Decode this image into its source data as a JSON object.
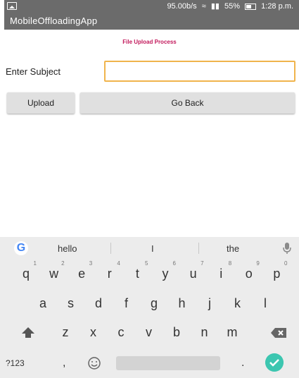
{
  "status_bar": {
    "speed": "95.00b/s",
    "battery": "55%",
    "time": "1:28 p.m."
  },
  "app": {
    "title": "MobileOffloadingApp"
  },
  "form": {
    "heading": "File Upload Process",
    "subject_label": "Enter Subject",
    "subject_value": "",
    "upload_label": "Upload",
    "go_back_label": "Go Back"
  },
  "keyboard": {
    "suggestions": [
      "hello",
      "I",
      "the"
    ],
    "row1": [
      {
        "k": "q",
        "n": "1"
      },
      {
        "k": "w",
        "n": "2"
      },
      {
        "k": "e",
        "n": "3"
      },
      {
        "k": "r",
        "n": "4"
      },
      {
        "k": "t",
        "n": "5"
      },
      {
        "k": "y",
        "n": "6"
      },
      {
        "k": "u",
        "n": "7"
      },
      {
        "k": "i",
        "n": "8"
      },
      {
        "k": "o",
        "n": "9"
      },
      {
        "k": "p",
        "n": "0"
      }
    ],
    "row2": [
      "a",
      "s",
      "d",
      "f",
      "g",
      "h",
      "j",
      "k",
      "l"
    ],
    "row3": [
      "z",
      "x",
      "c",
      "v",
      "b",
      "n",
      "m"
    ],
    "symbols_label": "?123",
    "comma": ",",
    "period": ".",
    "icons": [
      "google-g-icon",
      "mic-icon",
      "shift-icon",
      "backspace-icon",
      "emoji-icon",
      "enter-check-icon"
    ],
    "accent_color": "#3cc6b0"
  },
  "colors": {
    "status_bar": "#6b6b6b",
    "heading": "#c2185b",
    "input_border": "#f0b44c",
    "button_bg": "#e0e0e0"
  }
}
